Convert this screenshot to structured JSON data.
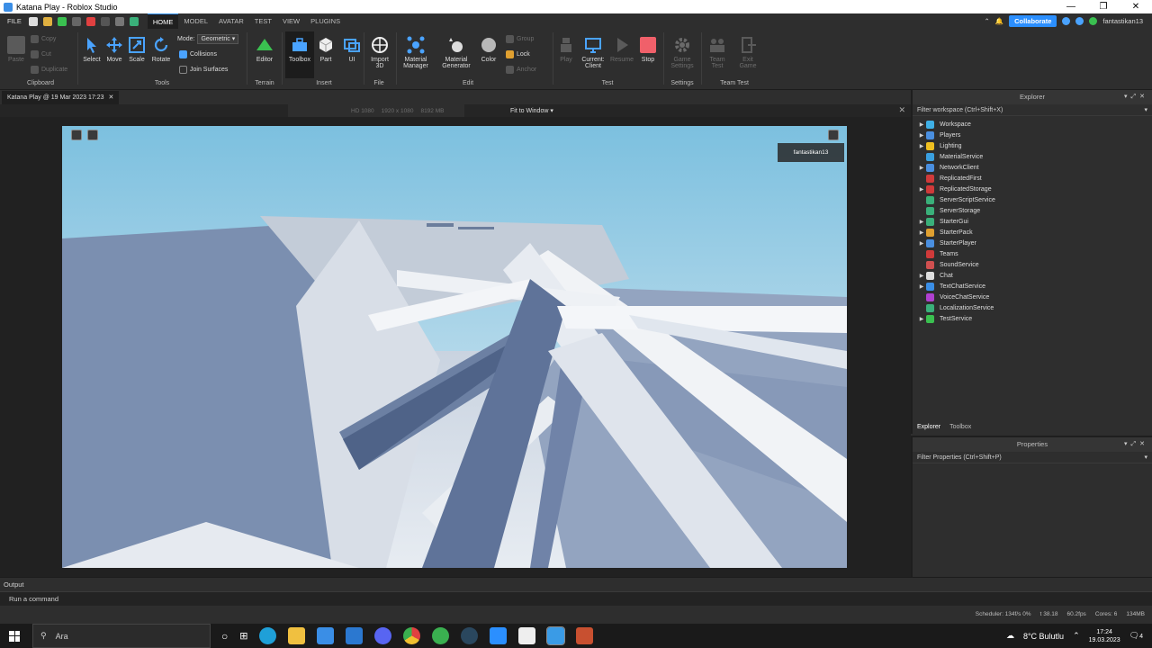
{
  "window": {
    "title": "Katana Play - Roblox Studio",
    "controls": [
      "—",
      "❐",
      "✕"
    ]
  },
  "menu": {
    "file": "FILE",
    "tabs": [
      "HOME",
      "MODEL",
      "AVATAR",
      "TEST",
      "VIEW",
      "PLUGINS"
    ],
    "active_tab": "HOME",
    "collaborate": "Collaborate",
    "username": "fantastikan13"
  },
  "ribbon": {
    "clipboard": {
      "paste": "Paste",
      "copy": "Copy",
      "cut": "Cut",
      "duplicate": "Duplicate",
      "group": "Clipboard"
    },
    "tools": {
      "select": "Select",
      "move": "Move",
      "scale": "Scale",
      "rotate": "Rotate",
      "mode_label": "Mode:",
      "mode_value": "Geometric",
      "collisions": "Collisions",
      "join_surfaces": "Join Surfaces",
      "group": "Tools"
    },
    "terrain": {
      "editor": "Editor",
      "group": "Terrain"
    },
    "insert": {
      "toolbox": "Toolbox",
      "part": "Part",
      "ui": "UI",
      "group": "Insert"
    },
    "file": {
      "import3d_1": "Import",
      "import3d_2": "3D",
      "group": "File"
    },
    "edit": {
      "material_manager_1": "Material",
      "material_manager_2": "Manager",
      "material_generator_1": "Material",
      "material_generator_2": "Generator",
      "color": "Color",
      "group_btn": "Group",
      "lock": "Lock",
      "anchor": "Anchor",
      "group": "Edit"
    },
    "test": {
      "play": "Play",
      "current_client_1": "Current:",
      "current_client_2": "Client",
      "resume": "Resume",
      "stop": "Stop",
      "group": "Test"
    },
    "settings": {
      "game_settings_1": "Game",
      "game_settings_2": "Settings",
      "group": "Settings"
    },
    "team_test": {
      "team_test_1": "Team",
      "team_test_2": "Test",
      "exit_game_1": "Exit",
      "exit_game_2": "Game",
      "group": "Team Test"
    }
  },
  "document": {
    "tab": "Katana Play @ 19 Mar 2023 17:23",
    "res_items": [
      "HD 1080",
      "1920 x 1080",
      "8192 MB"
    ],
    "fit": "Fit to Window"
  },
  "viewport": {
    "player_name": "fantastikan13"
  },
  "explorer": {
    "title": "Explorer",
    "filter": "Filter workspace (Ctrl+Shift+X)",
    "items": [
      {
        "label": "Workspace",
        "arrow": true,
        "color": "#3fb0e6"
      },
      {
        "label": "Players",
        "arrow": true,
        "color": "#4a8fe0"
      },
      {
        "label": "Lighting",
        "arrow": true,
        "color": "#f0c020"
      },
      {
        "label": "MaterialService",
        "arrow": false,
        "color": "#3aa0e0"
      },
      {
        "label": "NetworkClient",
        "arrow": true,
        "color": "#4a8fe0"
      },
      {
        "label": "ReplicatedFirst",
        "arrow": false,
        "color": "#d03a3a"
      },
      {
        "label": "ReplicatedStorage",
        "arrow": true,
        "color": "#d03a3a"
      },
      {
        "label": "ServerScriptService",
        "arrow": false,
        "color": "#3ab07a"
      },
      {
        "label": "ServerStorage",
        "arrow": false,
        "color": "#3ab07a"
      },
      {
        "label": "StarterGui",
        "arrow": true,
        "color": "#3ab07a"
      },
      {
        "label": "StarterPack",
        "arrow": true,
        "color": "#e0a030"
      },
      {
        "label": "StarterPlayer",
        "arrow": true,
        "color": "#4a8fe0"
      },
      {
        "label": "Teams",
        "arrow": false,
        "color": "#d03a3a"
      },
      {
        "label": "SoundService",
        "arrow": false,
        "color": "#d05050"
      },
      {
        "label": "Chat",
        "arrow": true,
        "color": "#dedede"
      },
      {
        "label": "TextChatService",
        "arrow": true,
        "color": "#3a8ee6"
      },
      {
        "label": "VoiceChatService",
        "arrow": false,
        "color": "#b040d0"
      },
      {
        "label": "LocalizationService",
        "arrow": false,
        "color": "#3ab07a"
      },
      {
        "label": "TestService",
        "arrow": true,
        "color": "#3ac050"
      }
    ],
    "tabs": [
      "Explorer",
      "Toolbox"
    ]
  },
  "properties": {
    "title": "Properties",
    "filter": "Filter Properties (Ctrl+Shift+P)"
  },
  "output": {
    "title": "Output",
    "command_placeholder": "Run a command"
  },
  "status": {
    "stats": [
      "Scheduler: 134f/s 0%",
      "t 38.18",
      "60.2fps",
      "Cores: 6",
      "134MB"
    ]
  },
  "taskbar": {
    "search_placeholder": "Ara",
    "weather": "8°C  Bulutlu",
    "time": "17:24",
    "date": "19.03.2023",
    "notifications": "4"
  }
}
